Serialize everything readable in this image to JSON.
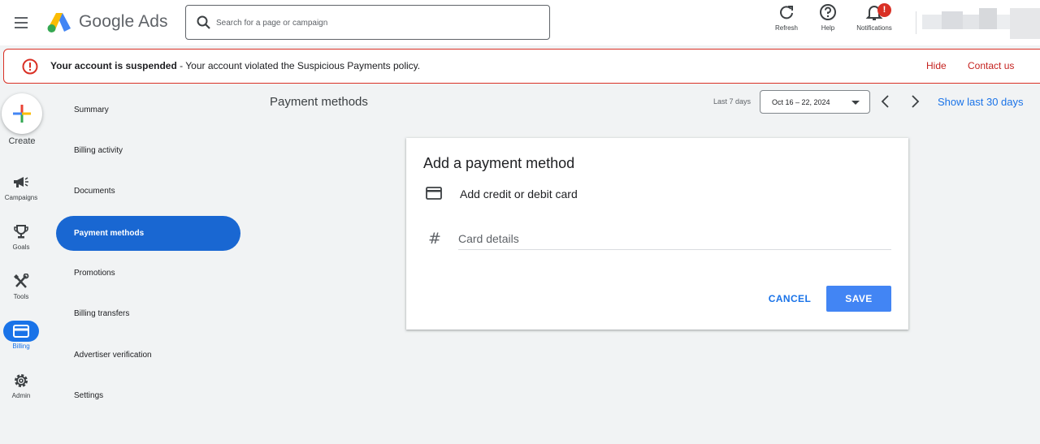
{
  "header": {
    "app_name": "Google Ads",
    "search_placeholder": "Search for a page or campaign",
    "actions": [
      {
        "label": "Refresh",
        "icon": "refresh-icon"
      },
      {
        "label": "Help",
        "icon": "help-icon"
      },
      {
        "label": "Notifications",
        "icon": "bell-icon",
        "badge": "!"
      }
    ]
  },
  "alert": {
    "title": "Your account is suspended",
    "message": " - Your account violated the Suspicious Payments policy.",
    "hide_label": "Hide",
    "contact_label": "Contact us",
    "icon": "alert-circle-icon"
  },
  "rail": {
    "create_label": "Create",
    "items": [
      {
        "label": "Campaigns",
        "icon": "megaphone-icon"
      },
      {
        "label": "Goals",
        "icon": "trophy-icon"
      },
      {
        "label": "Tools",
        "icon": "tools-icon"
      },
      {
        "label": "Billing",
        "icon": "credit-card-icon",
        "active": true
      },
      {
        "label": "Admin",
        "icon": "gear-icon"
      }
    ]
  },
  "billing_nav": {
    "items": [
      {
        "label": "Summary"
      },
      {
        "label": "Billing activity"
      },
      {
        "label": "Documents"
      },
      {
        "label": "Payment methods",
        "active": true
      },
      {
        "label": "Promotions"
      },
      {
        "label": "Billing transfers"
      },
      {
        "label": "Advertiser verification"
      },
      {
        "label": "Settings"
      }
    ]
  },
  "main": {
    "page_title": "Payment methods",
    "range_label": "Last 7 days",
    "date_range": "Oct 16 – 22, 2024",
    "show_last_30": "Show last 30 days"
  },
  "card": {
    "title": "Add a payment method",
    "option_label": "Add credit or debit card",
    "field_placeholder": "Card details",
    "field_icon": "#",
    "cancel_label": "CANCEL",
    "save_label": "SAVE"
  },
  "colors": {
    "accent": "#1a73e8",
    "active_nav": "#1967d2",
    "save_button": "#4285f4",
    "alert_border": "#d93025",
    "alert_link": "#c5221f",
    "background": "#f1f3f4"
  }
}
